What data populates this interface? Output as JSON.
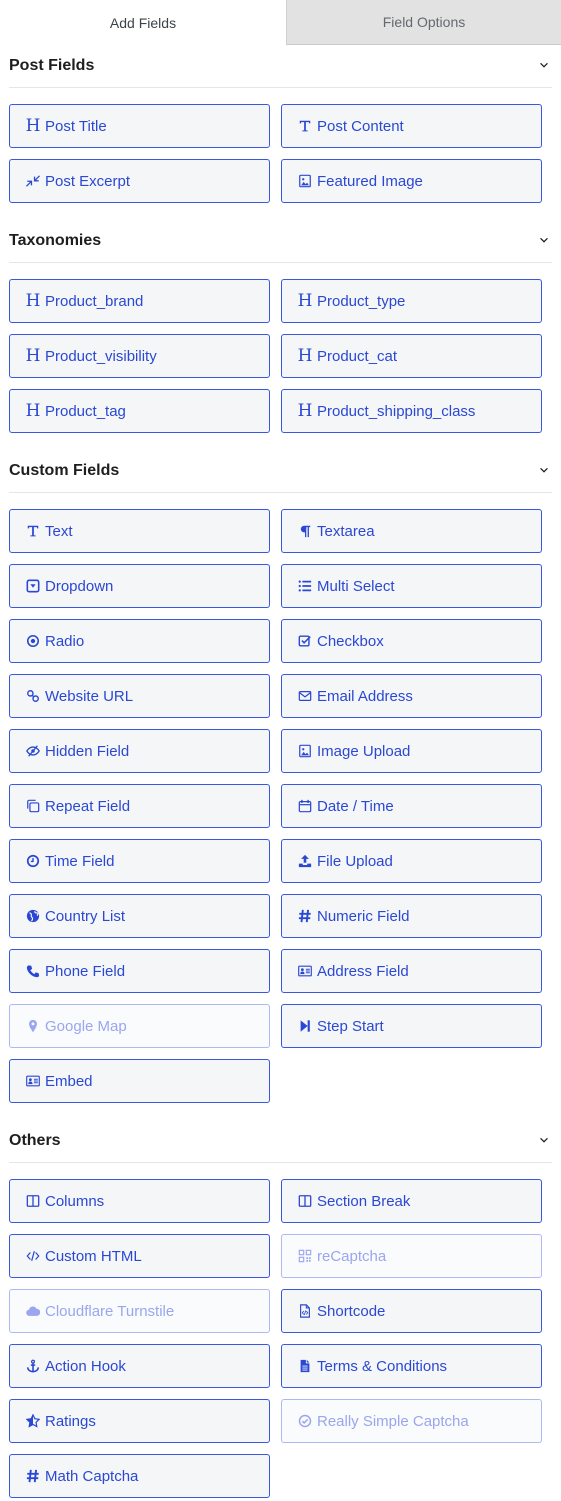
{
  "tabs": [
    {
      "label": "Add Fields",
      "active": true
    },
    {
      "label": "Field Options",
      "active": false
    }
  ],
  "colors": {
    "accent": "#2a48d4",
    "button_border": "#3858e0",
    "button_bg": "#f5f6f7",
    "disabled_text": "#9aa6ef",
    "inactive_tab_bg": "#e2e2e2"
  },
  "sections": [
    {
      "title": "Post Fields",
      "collapse_icon": "chevron-down-icon",
      "fields": [
        {
          "label": "Post Title",
          "icon": "heading-icon",
          "disabled": false
        },
        {
          "label": "Post Content",
          "icon": "text-cursor-icon",
          "disabled": false
        },
        {
          "label": "Post Excerpt",
          "icon": "compress-icon",
          "disabled": false
        },
        {
          "label": "Featured Image",
          "icon": "image-icon",
          "disabled": false
        }
      ]
    },
    {
      "title": "Taxonomies",
      "collapse_icon": "chevron-down-icon",
      "fields": [
        {
          "label": "Product_brand",
          "icon": "heading-icon",
          "disabled": false
        },
        {
          "label": "Product_type",
          "icon": "heading-icon",
          "disabled": false
        },
        {
          "label": "Product_visibility",
          "icon": "heading-icon",
          "disabled": false
        },
        {
          "label": "Product_cat",
          "icon": "heading-icon",
          "disabled": false
        },
        {
          "label": "Product_tag",
          "icon": "heading-icon",
          "disabled": false
        },
        {
          "label": "Product_shipping_class",
          "icon": "heading-icon",
          "disabled": false
        }
      ]
    },
    {
      "title": "Custom Fields",
      "collapse_icon": "chevron-down-icon",
      "fields": [
        {
          "label": "Text",
          "icon": "text-cursor-icon",
          "disabled": false
        },
        {
          "label": "Textarea",
          "icon": "paragraph-icon",
          "disabled": false
        },
        {
          "label": "Dropdown",
          "icon": "dropdown-icon",
          "disabled": false
        },
        {
          "label": "Multi Select",
          "icon": "list-icon",
          "disabled": false
        },
        {
          "label": "Radio",
          "icon": "radio-icon",
          "disabled": false
        },
        {
          "label": "Checkbox",
          "icon": "checkbox-icon",
          "disabled": false
        },
        {
          "label": "Website URL",
          "icon": "link-icon",
          "disabled": false
        },
        {
          "label": "Email Address",
          "icon": "envelope-icon",
          "disabled": false
        },
        {
          "label": "Hidden Field",
          "icon": "eye-slash-icon",
          "disabled": false
        },
        {
          "label": "Image Upload",
          "icon": "image-icon",
          "disabled": false
        },
        {
          "label": "Repeat Field",
          "icon": "copy-icon",
          "disabled": false
        },
        {
          "label": "Date / Time",
          "icon": "calendar-icon",
          "disabled": false
        },
        {
          "label": "Time Field",
          "icon": "clock-icon",
          "disabled": false
        },
        {
          "label": "File Upload",
          "icon": "upload-icon",
          "disabled": false
        },
        {
          "label": "Country List",
          "icon": "globe-icon",
          "disabled": false
        },
        {
          "label": "Numeric Field",
          "icon": "hash-icon",
          "disabled": false
        },
        {
          "label": "Phone Field",
          "icon": "phone-icon",
          "disabled": false
        },
        {
          "label": "Address Field",
          "icon": "address-card-icon",
          "disabled": false
        },
        {
          "label": "Google Map",
          "icon": "map-marker-icon",
          "disabled": true
        },
        {
          "label": "Step Start",
          "icon": "step-forward-icon",
          "disabled": false
        },
        {
          "label": "Embed",
          "icon": "address-card-icon",
          "disabled": false
        }
      ]
    },
    {
      "title": "Others",
      "collapse_icon": "chevron-down-icon",
      "fields": [
        {
          "label": "Columns",
          "icon": "columns-icon",
          "disabled": false
        },
        {
          "label": "Section Break",
          "icon": "columns-icon",
          "disabled": false
        },
        {
          "label": "Custom HTML",
          "icon": "code-icon",
          "disabled": false
        },
        {
          "label": "reCaptcha",
          "icon": "qrcode-icon",
          "disabled": true
        },
        {
          "label": "Cloudflare Turnstile",
          "icon": "cloud-icon",
          "disabled": true
        },
        {
          "label": "Shortcode",
          "icon": "file-code-icon",
          "disabled": false
        },
        {
          "label": "Action Hook",
          "icon": "anchor-icon",
          "disabled": false
        },
        {
          "label": "Terms & Conditions",
          "icon": "file-text-icon",
          "disabled": false
        },
        {
          "label": "Ratings",
          "icon": "star-half-icon",
          "disabled": false
        },
        {
          "label": "Really Simple Captcha",
          "icon": "check-circle-icon",
          "disabled": true
        },
        {
          "label": "Math Captcha",
          "icon": "hash-icon",
          "disabled": false
        }
      ]
    }
  ]
}
